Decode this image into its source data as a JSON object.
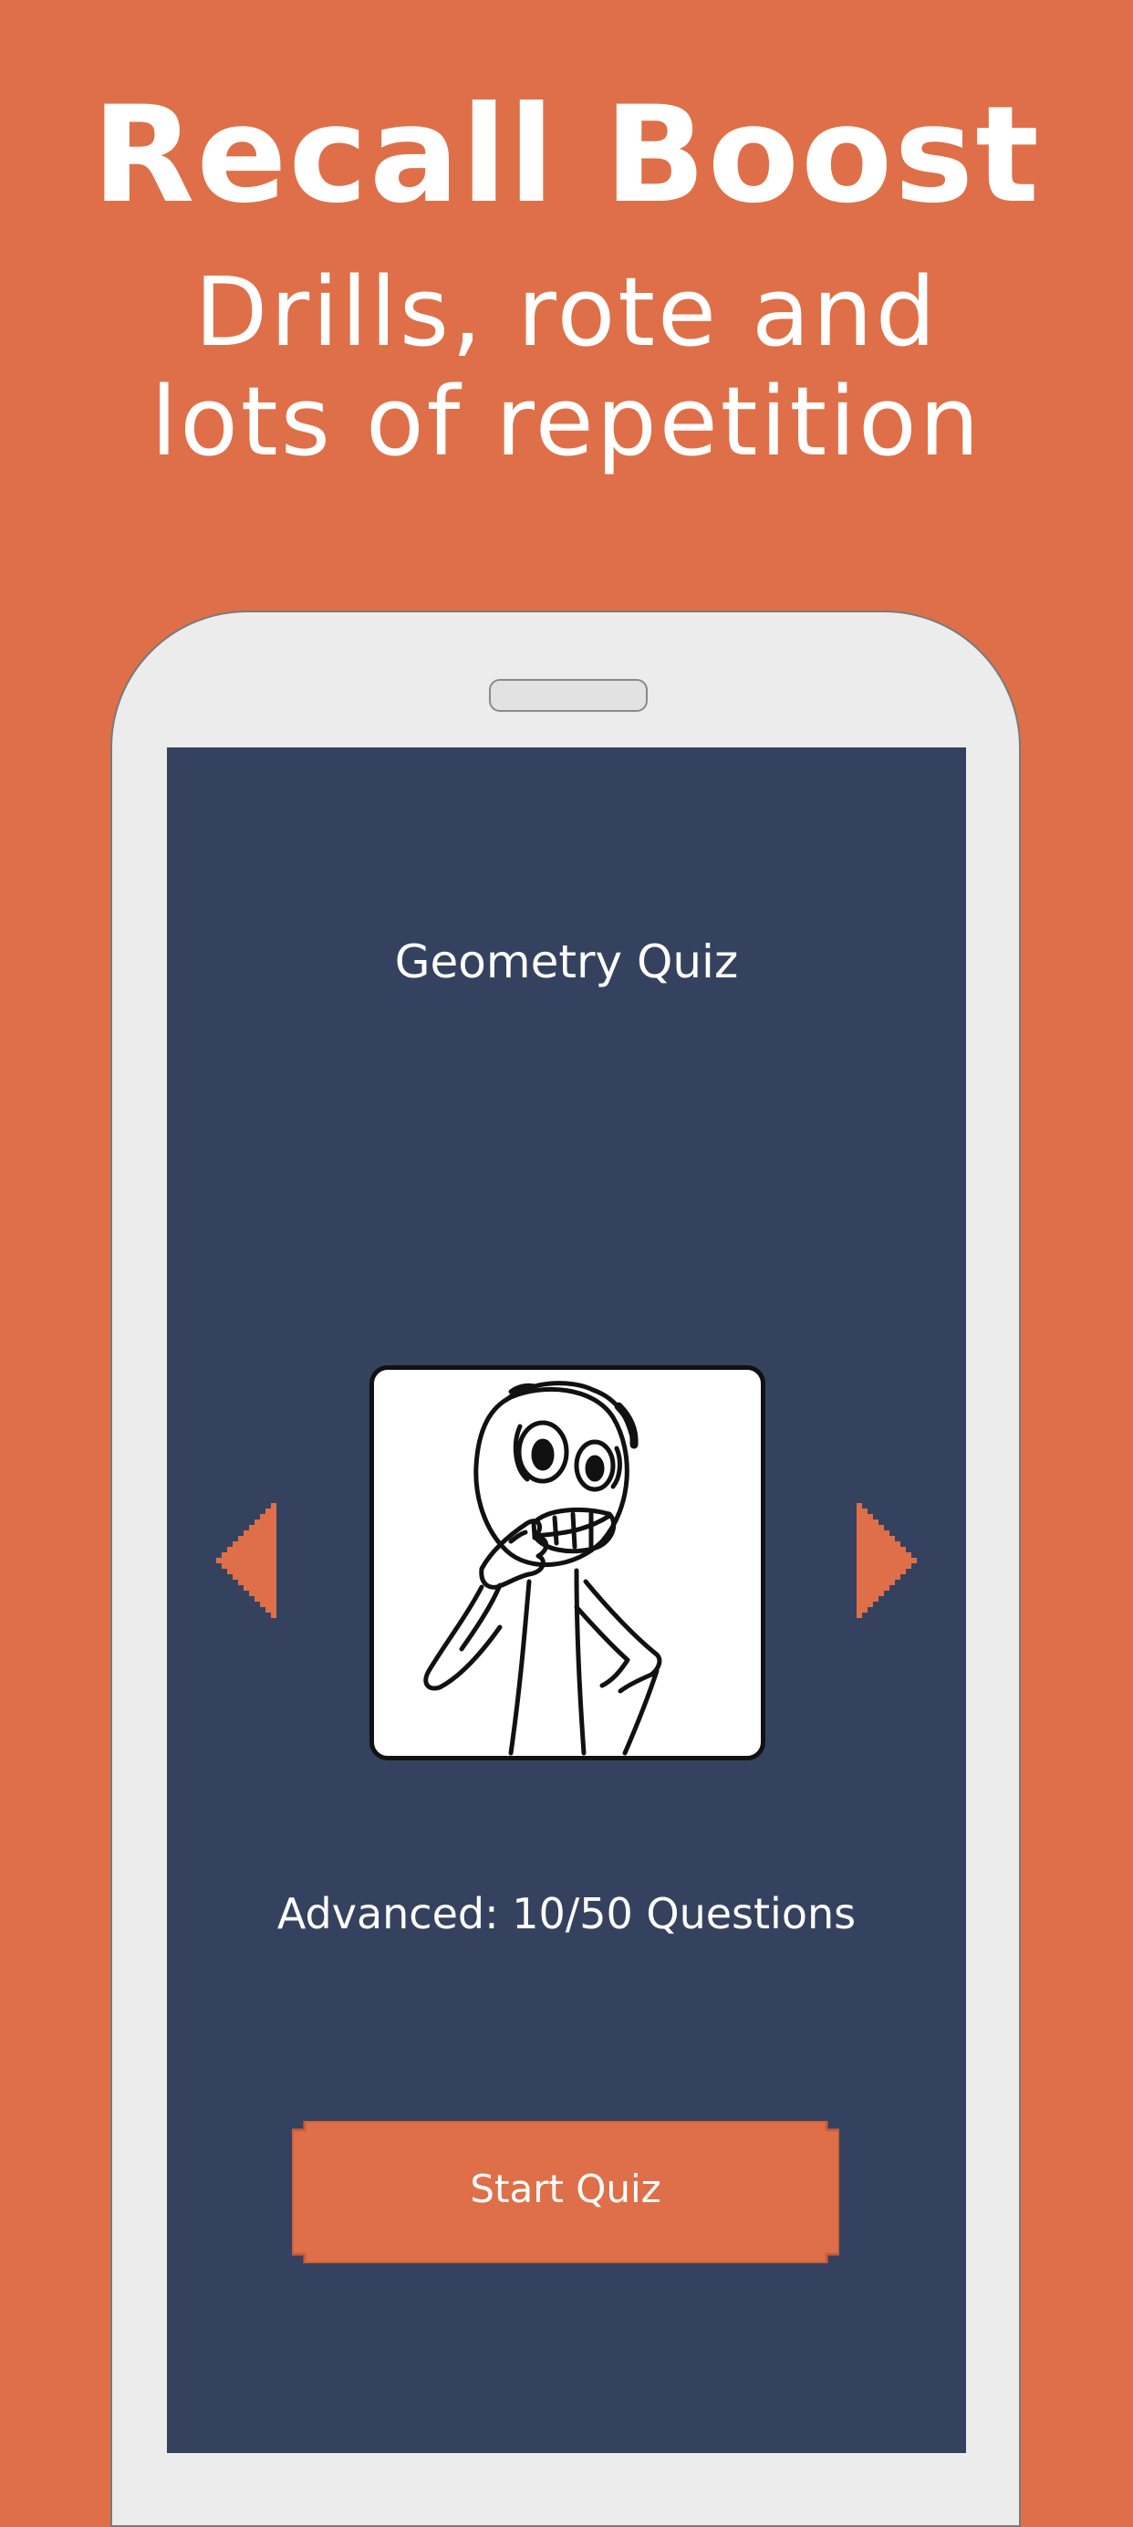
{
  "promo": {
    "headline": "Recall Boost",
    "tagline_line1": "Drills, rote and",
    "tagline_line2": "lots of repetition"
  },
  "colors": {
    "background": "#df6f48",
    "screen": "#35425f",
    "accent": "#df6f48",
    "device_frame": "#ececec"
  },
  "quiz": {
    "title": "Geometry Quiz",
    "level_text": "Advanced: 10/50 Questions",
    "start_button_label": "Start Quiz",
    "card_image": "nervous-stick-figure-illustration"
  },
  "icons": {
    "previous": "caret-left-icon",
    "next": "caret-right-icon"
  }
}
